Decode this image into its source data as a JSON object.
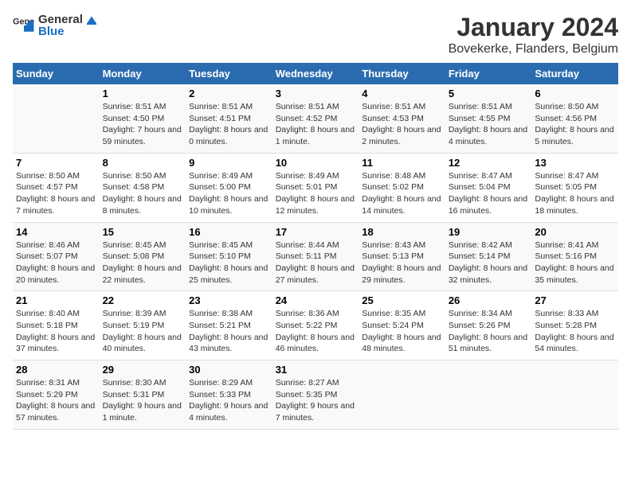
{
  "logo": {
    "text_general": "General",
    "text_blue": "Blue"
  },
  "title": "January 2024",
  "subtitle": "Bovekerke, Flanders, Belgium",
  "days_header": [
    "Sunday",
    "Monday",
    "Tuesday",
    "Wednesday",
    "Thursday",
    "Friday",
    "Saturday"
  ],
  "weeks": [
    [
      {
        "num": "",
        "sunrise": "",
        "sunset": "",
        "daylight": ""
      },
      {
        "num": "1",
        "sunrise": "Sunrise: 8:51 AM",
        "sunset": "Sunset: 4:50 PM",
        "daylight": "Daylight: 7 hours and 59 minutes."
      },
      {
        "num": "2",
        "sunrise": "Sunrise: 8:51 AM",
        "sunset": "Sunset: 4:51 PM",
        "daylight": "Daylight: 8 hours and 0 minutes."
      },
      {
        "num": "3",
        "sunrise": "Sunrise: 8:51 AM",
        "sunset": "Sunset: 4:52 PM",
        "daylight": "Daylight: 8 hours and 1 minute."
      },
      {
        "num": "4",
        "sunrise": "Sunrise: 8:51 AM",
        "sunset": "Sunset: 4:53 PM",
        "daylight": "Daylight: 8 hours and 2 minutes."
      },
      {
        "num": "5",
        "sunrise": "Sunrise: 8:51 AM",
        "sunset": "Sunset: 4:55 PM",
        "daylight": "Daylight: 8 hours and 4 minutes."
      },
      {
        "num": "6",
        "sunrise": "Sunrise: 8:50 AM",
        "sunset": "Sunset: 4:56 PM",
        "daylight": "Daylight: 8 hours and 5 minutes."
      }
    ],
    [
      {
        "num": "7",
        "sunrise": "Sunrise: 8:50 AM",
        "sunset": "Sunset: 4:57 PM",
        "daylight": "Daylight: 8 hours and 7 minutes."
      },
      {
        "num": "8",
        "sunrise": "Sunrise: 8:50 AM",
        "sunset": "Sunset: 4:58 PM",
        "daylight": "Daylight: 8 hours and 8 minutes."
      },
      {
        "num": "9",
        "sunrise": "Sunrise: 8:49 AM",
        "sunset": "Sunset: 5:00 PM",
        "daylight": "Daylight: 8 hours and 10 minutes."
      },
      {
        "num": "10",
        "sunrise": "Sunrise: 8:49 AM",
        "sunset": "Sunset: 5:01 PM",
        "daylight": "Daylight: 8 hours and 12 minutes."
      },
      {
        "num": "11",
        "sunrise": "Sunrise: 8:48 AM",
        "sunset": "Sunset: 5:02 PM",
        "daylight": "Daylight: 8 hours and 14 minutes."
      },
      {
        "num": "12",
        "sunrise": "Sunrise: 8:47 AM",
        "sunset": "Sunset: 5:04 PM",
        "daylight": "Daylight: 8 hours and 16 minutes."
      },
      {
        "num": "13",
        "sunrise": "Sunrise: 8:47 AM",
        "sunset": "Sunset: 5:05 PM",
        "daylight": "Daylight: 8 hours and 18 minutes."
      }
    ],
    [
      {
        "num": "14",
        "sunrise": "Sunrise: 8:46 AM",
        "sunset": "Sunset: 5:07 PM",
        "daylight": "Daylight: 8 hours and 20 minutes."
      },
      {
        "num": "15",
        "sunrise": "Sunrise: 8:45 AM",
        "sunset": "Sunset: 5:08 PM",
        "daylight": "Daylight: 8 hours and 22 minutes."
      },
      {
        "num": "16",
        "sunrise": "Sunrise: 8:45 AM",
        "sunset": "Sunset: 5:10 PM",
        "daylight": "Daylight: 8 hours and 25 minutes."
      },
      {
        "num": "17",
        "sunrise": "Sunrise: 8:44 AM",
        "sunset": "Sunset: 5:11 PM",
        "daylight": "Daylight: 8 hours and 27 minutes."
      },
      {
        "num": "18",
        "sunrise": "Sunrise: 8:43 AM",
        "sunset": "Sunset: 5:13 PM",
        "daylight": "Daylight: 8 hours and 29 minutes."
      },
      {
        "num": "19",
        "sunrise": "Sunrise: 8:42 AM",
        "sunset": "Sunset: 5:14 PM",
        "daylight": "Daylight: 8 hours and 32 minutes."
      },
      {
        "num": "20",
        "sunrise": "Sunrise: 8:41 AM",
        "sunset": "Sunset: 5:16 PM",
        "daylight": "Daylight: 8 hours and 35 minutes."
      }
    ],
    [
      {
        "num": "21",
        "sunrise": "Sunrise: 8:40 AM",
        "sunset": "Sunset: 5:18 PM",
        "daylight": "Daylight: 8 hours and 37 minutes."
      },
      {
        "num": "22",
        "sunrise": "Sunrise: 8:39 AM",
        "sunset": "Sunset: 5:19 PM",
        "daylight": "Daylight: 8 hours and 40 minutes."
      },
      {
        "num": "23",
        "sunrise": "Sunrise: 8:38 AM",
        "sunset": "Sunset: 5:21 PM",
        "daylight": "Daylight: 8 hours and 43 minutes."
      },
      {
        "num": "24",
        "sunrise": "Sunrise: 8:36 AM",
        "sunset": "Sunset: 5:22 PM",
        "daylight": "Daylight: 8 hours and 46 minutes."
      },
      {
        "num": "25",
        "sunrise": "Sunrise: 8:35 AM",
        "sunset": "Sunset: 5:24 PM",
        "daylight": "Daylight: 8 hours and 48 minutes."
      },
      {
        "num": "26",
        "sunrise": "Sunrise: 8:34 AM",
        "sunset": "Sunset: 5:26 PM",
        "daylight": "Daylight: 8 hours and 51 minutes."
      },
      {
        "num": "27",
        "sunrise": "Sunrise: 8:33 AM",
        "sunset": "Sunset: 5:28 PM",
        "daylight": "Daylight: 8 hours and 54 minutes."
      }
    ],
    [
      {
        "num": "28",
        "sunrise": "Sunrise: 8:31 AM",
        "sunset": "Sunset: 5:29 PM",
        "daylight": "Daylight: 8 hours and 57 minutes."
      },
      {
        "num": "29",
        "sunrise": "Sunrise: 8:30 AM",
        "sunset": "Sunset: 5:31 PM",
        "daylight": "Daylight: 9 hours and 1 minute."
      },
      {
        "num": "30",
        "sunrise": "Sunrise: 8:29 AM",
        "sunset": "Sunset: 5:33 PM",
        "daylight": "Daylight: 9 hours and 4 minutes."
      },
      {
        "num": "31",
        "sunrise": "Sunrise: 8:27 AM",
        "sunset": "Sunset: 5:35 PM",
        "daylight": "Daylight: 9 hours and 7 minutes."
      },
      {
        "num": "",
        "sunrise": "",
        "sunset": "",
        "daylight": ""
      },
      {
        "num": "",
        "sunrise": "",
        "sunset": "",
        "daylight": ""
      },
      {
        "num": "",
        "sunrise": "",
        "sunset": "",
        "daylight": ""
      }
    ]
  ]
}
